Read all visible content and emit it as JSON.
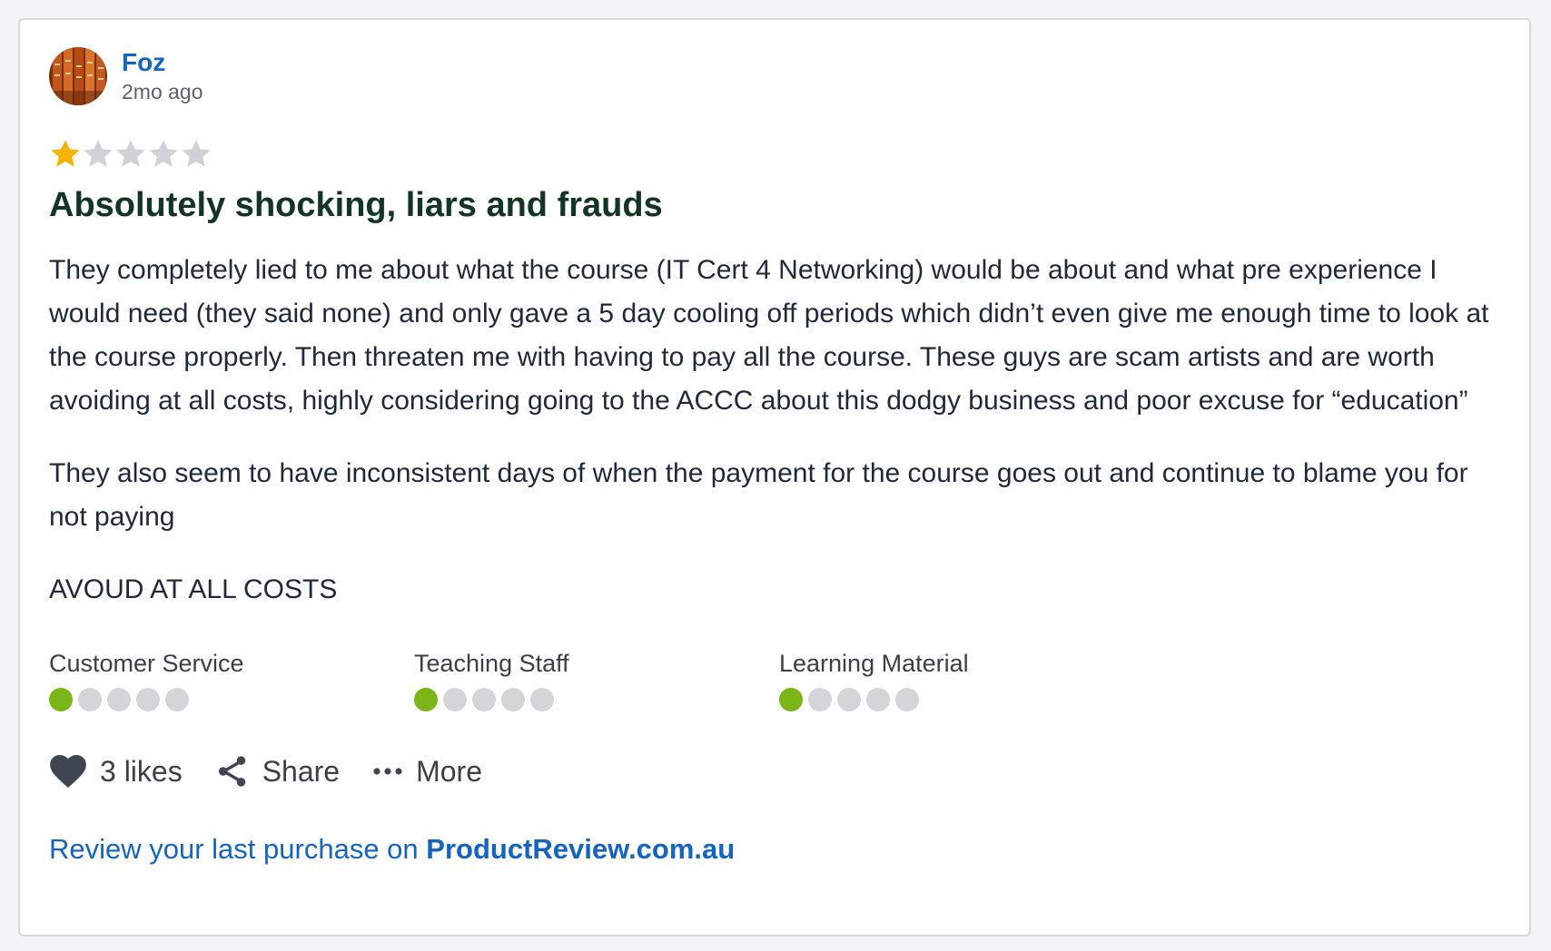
{
  "review": {
    "author": {
      "name": "Foz",
      "time_ago": "2mo ago",
      "avatar_icon": "books-avatar"
    },
    "rating": {
      "value": 1,
      "max": 5,
      "filled_color": "#f6b400",
      "empty_color": "#cfd2d6"
    },
    "title": "Absolutely shocking, liars and frauds",
    "paragraphs": [
      "They completely lied to me about what the course (IT Cert 4 Networking) would be about and what pre experience I would need (they said none) and only gave a 5 day cooling off periods which didn’t even give me enough time to look at the course properly. Then threaten me with having to pay all the course. These guys are scam artists and are worth avoiding at all costs, highly considering going to the ACCC about this dodgy business and poor excuse for “education”",
      "They also seem to have inconsistent days of when the payment for the course goes out and continue to blame you for not paying",
      "AVOUD AT ALL COSTS"
    ],
    "sub_ratings": [
      {
        "label": "Customer Service",
        "value": 1,
        "max": 5
      },
      {
        "label": "Teaching Staff",
        "value": 1,
        "max": 5
      },
      {
        "label": "Learning Material",
        "value": 1,
        "max": 5
      }
    ],
    "sub_rating_color": "#7cb518",
    "actions": {
      "likes_label": "3 likes",
      "likes_icon": "heart-icon",
      "share_label": "Share",
      "share_icon": "share-icon",
      "more_label": "More",
      "more_icon": "more-dots-icon"
    },
    "footer": {
      "prefix": "Review your last purchase on ",
      "link_text": "ProductReview.com.au"
    }
  }
}
